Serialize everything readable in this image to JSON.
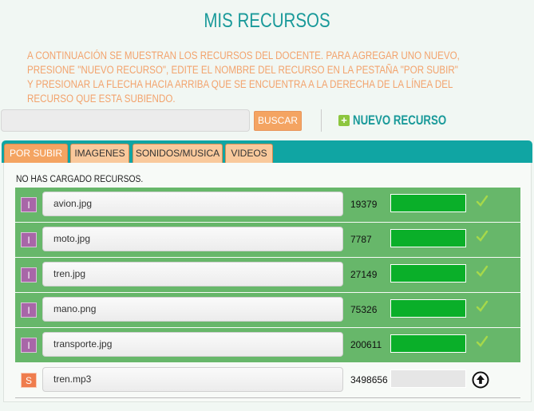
{
  "page": {
    "title": "MIS RECURSOS",
    "intro": "A CONTINUACIÓN SE MUESTRAN LOS RECURSOS DEL DOCENTE. PARA AGREGAR UNO NUEVO, PRESIONE \"NUEVO RECURSO\", EDITE EL NOMBRE DEL RECURSO EN LA PESTAÑA \"POR SUBIR\" Y PRESIONAR LA FLECHA HACIA ARRIBA QUE SE ENCUENTRA A LA DERECHA DE LA LÍNEA DEL RECURSO QUE ESTA SUBIENDO."
  },
  "search": {
    "value": "",
    "placeholder": "",
    "button_label": "BUSCAR"
  },
  "new_resource": {
    "label": "NUEVO RECURSO",
    "icon": "plus-icon"
  },
  "tabs": [
    {
      "label": "POR SUBIR",
      "active": true
    },
    {
      "label": "IMAGENES",
      "active": false
    },
    {
      "label": "SONIDOS/MUSICA",
      "active": false
    },
    {
      "label": "VIDEOS",
      "active": false
    }
  ],
  "panel": {
    "empty_text": "NO HAS CARGADO RECURSOS."
  },
  "resources": [
    {
      "type": "I",
      "name": "avion.jpg",
      "size": "19379",
      "progress": 1.0,
      "status": "done"
    },
    {
      "type": "I",
      "name": "moto.jpg",
      "size": "7787",
      "progress": 1.0,
      "status": "done"
    },
    {
      "type": "I",
      "name": "tren.jpg",
      "size": "27149",
      "progress": 1.0,
      "status": "done"
    },
    {
      "type": "I",
      "name": "mano.png",
      "size": "75326",
      "progress": 1.0,
      "status": "done"
    },
    {
      "type": "I",
      "name": "transporte.jpg",
      "size": "200611",
      "progress": 1.0,
      "status": "done"
    },
    {
      "type": "S",
      "name": "tren.mp3",
      "size": "3498656",
      "progress": 0.0,
      "status": "pending"
    }
  ],
  "colors": {
    "accent": "#1a9a9a",
    "intro_text": "#f2a36d",
    "button": "#f4a462",
    "tab_bar": "#10a5a3",
    "row_done": "#67b76a",
    "progress_fill": "#0aaf29",
    "badge_image": "#a866a8",
    "badge_sound": "#ef7d4d",
    "check": "#a6d84a"
  }
}
